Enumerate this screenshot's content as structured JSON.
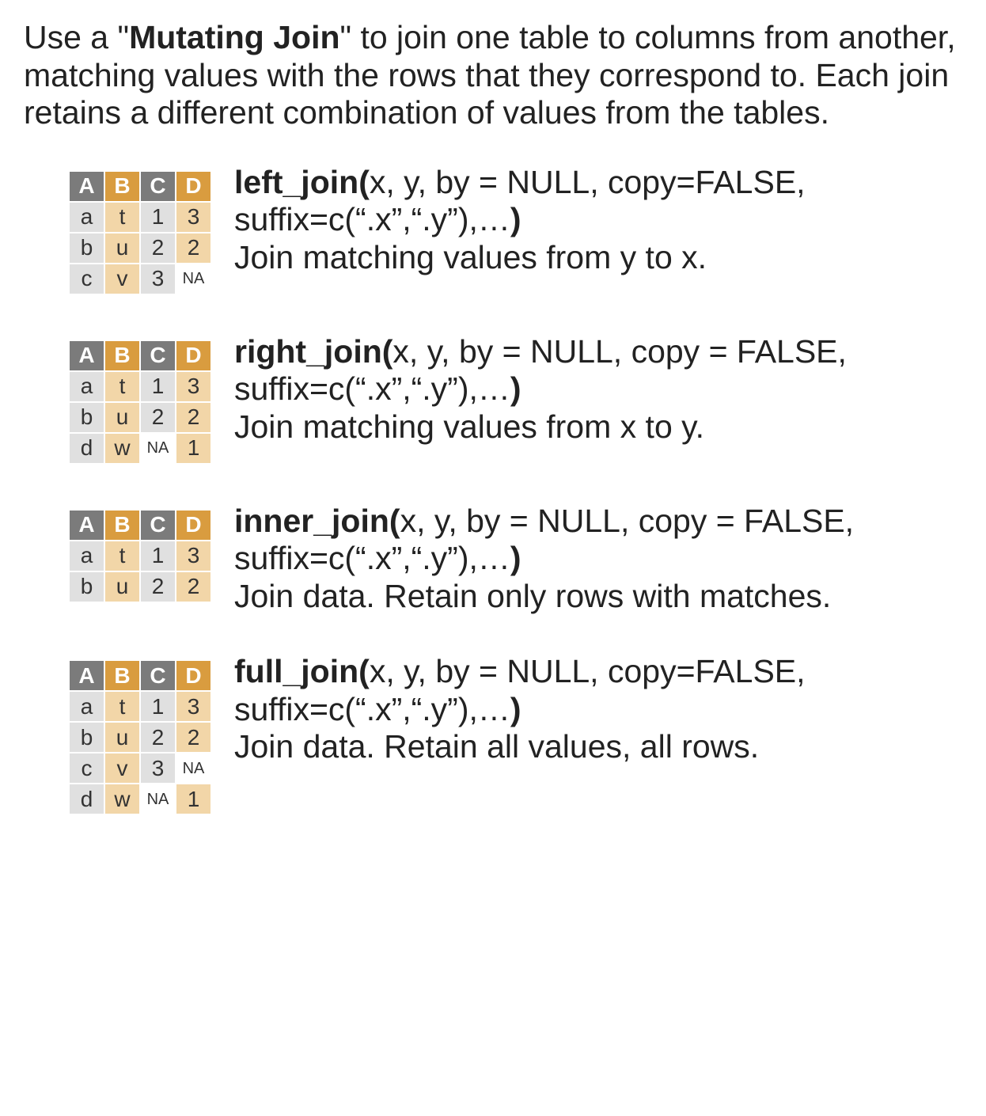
{
  "intro": {
    "pre": "Use a \"",
    "bold": "Mutating Join",
    "post": "\" to join one table to columns from another, matching values with the rows that they correspond to.  Each join retains a different combination of values from the tables."
  },
  "headers": [
    "A",
    "B",
    "C",
    "D"
  ],
  "joins": [
    {
      "name": "left_join",
      "sig_open": "(",
      "sig_body": "x, y, by = NULL, copy=FALSE,  suffix=c(“.x”,“.y”),…",
      "sig_close": ")",
      "expl": "Join matching values from y to x.",
      "rows": [
        [
          "a",
          "t",
          "1",
          "3"
        ],
        [
          "b",
          "u",
          "2",
          "2"
        ],
        [
          "c",
          "v",
          "3",
          "NA"
        ]
      ]
    },
    {
      "name": "right_join",
      "sig_open": "(",
      "sig_body": "x, y, by = NULL, copy = FALSE,  suffix=c(“.x”,“.y”),…",
      "sig_close": ")",
      "expl": "Join matching values from x to y.",
      "rows": [
        [
          "a",
          "t",
          "1",
          "3"
        ],
        [
          "b",
          "u",
          "2",
          "2"
        ],
        [
          "d",
          "w",
          "NA",
          "1"
        ]
      ]
    },
    {
      "name": "inner_join",
      "sig_open": "(",
      "sig_body": "x, y, by = NULL, copy = FALSE,  suffix=c(“.x”,“.y”),…",
      "sig_close": ")",
      "expl": "Join data. Retain only rows with matches.",
      "rows": [
        [
          "a",
          "t",
          "1",
          "3"
        ],
        [
          "b",
          "u",
          "2",
          "2"
        ]
      ]
    },
    {
      "name": "full_join",
      "sig_open": "(",
      "sig_body": "x, y, by = NULL, copy=FALSE,  suffix=c(“.x”,“.y”),…",
      "sig_close": ")",
      "expl": "Join data. Retain all values, all rows.",
      "rows": [
        [
          "a",
          "t",
          "1",
          "3"
        ],
        [
          "b",
          "u",
          "2",
          "2"
        ],
        [
          "c",
          "v",
          "3",
          "NA"
        ],
        [
          "d",
          "w",
          "NA",
          "1"
        ]
      ]
    }
  ]
}
